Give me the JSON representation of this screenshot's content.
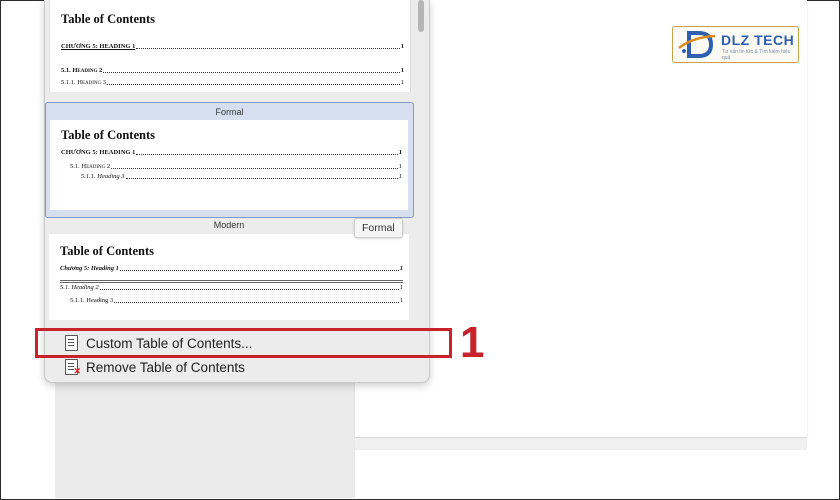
{
  "brand": {
    "logo_text": "DLZ TECH",
    "logo_tagline": "Tư vấn tin tức & Tìm kiếm hiệu quả"
  },
  "gallery": {
    "items": [
      {
        "label": "",
        "title": "Table of Contents",
        "lines": [
          {
            "text": "CHƯƠNG 5: HEADING 1",
            "page": "1"
          },
          {
            "text": "5.1. Heading 2",
            "page": "1"
          },
          {
            "text": "5.1.1. Heading 3",
            "page": "1"
          }
        ]
      },
      {
        "label": "Formal",
        "title": "Table of Contents",
        "lines": [
          {
            "text": "CHƯƠNG 5: HEADING 1",
            "page": "1"
          },
          {
            "text": "5.1. Heading 2",
            "page": "1"
          },
          {
            "text": "5.1.1. Heading 3",
            "page": "1"
          }
        ]
      },
      {
        "label": "Modern",
        "title": "Table of Contents",
        "lines": [
          {
            "text": "Chương 5: Heading 1",
            "page": "1"
          },
          {
            "text": "5.1. Heading 2",
            "page": "1"
          },
          {
            "text": "5.1.1. Heading 3",
            "page": "1"
          }
        ]
      }
    ],
    "tooltip": "Formal",
    "selected": "Formal"
  },
  "menu": {
    "custom_label": "Custom Table of Contents...",
    "remove_label": "Remove Table of Contents"
  },
  "annotation": {
    "step_number": "1",
    "color": "#c8232c"
  },
  "icons": {
    "custom": "document-list-icon",
    "remove": "document-remove-icon",
    "logo": "dlz-logo-icon"
  }
}
